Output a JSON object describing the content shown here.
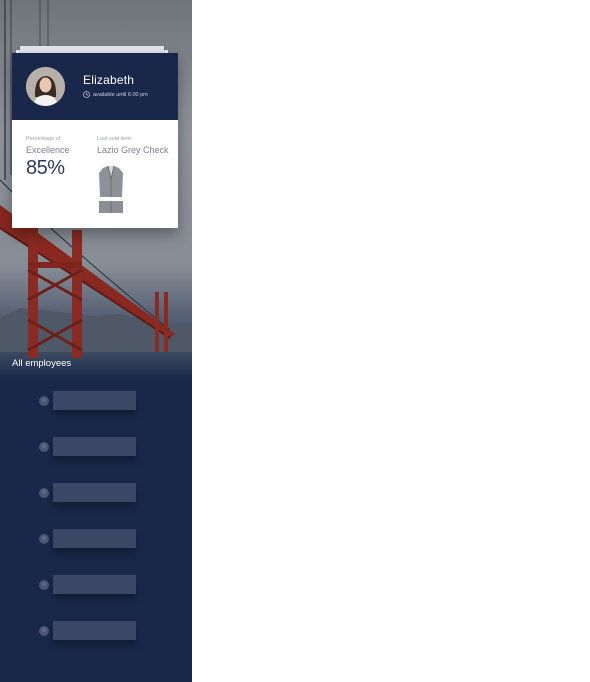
{
  "profile": {
    "name": "Elizabeth",
    "availability": "available until 6.00 pm",
    "stats": [
      {
        "caption": "Percentage of",
        "title": "Excellence",
        "value": "85%"
      },
      {
        "caption": "Last sold item",
        "title": "Lazio Grey Check"
      }
    ]
  },
  "employees": {
    "title": "All employees",
    "count": 6
  },
  "colors": {
    "navy": "#19284a",
    "bridge_red": "#9b2a22",
    "row_bar": "#3f4b69"
  },
  "icons": [
    "clock-icon",
    "avatar",
    "suit-image",
    "employee-avatar-icon"
  ]
}
